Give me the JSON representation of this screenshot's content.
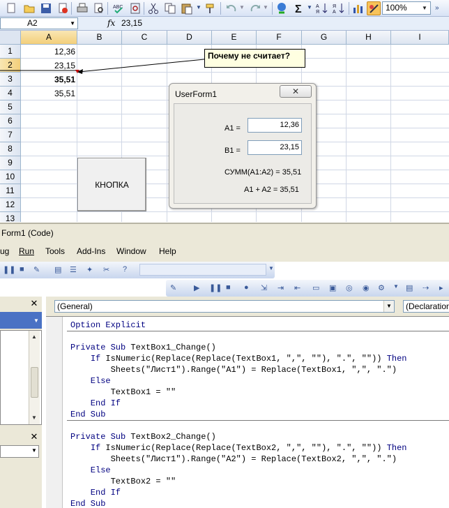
{
  "excel": {
    "zoom": "100%",
    "name_box": "A2",
    "fx": "fx",
    "formula_value": "23,15",
    "columns": [
      "A",
      "B",
      "C",
      "D",
      "E",
      "F",
      "G",
      "H",
      "I"
    ],
    "rows": [
      "1",
      "2",
      "3",
      "4",
      "5",
      "6",
      "7",
      "8",
      "9",
      "10",
      "11",
      "12",
      "13"
    ],
    "cells": {
      "a1": "12,36",
      "a2": "23,15",
      "a3": "35,51",
      "a4": "35,51"
    },
    "comment": "Почему не считает?",
    "sheet_button": "КНОПКА"
  },
  "userform": {
    "title": "UserForm1",
    "label_a1": "A1 =",
    "value_a1": "12,36",
    "label_b1": "B1 =",
    "value_b1": "23,15",
    "sum_text": "СУММ(A1:A2) = 35,51",
    "plus_text": "A1 + A2 = 35,51"
  },
  "vbe": {
    "window_title": "Form1 (Code)",
    "menu": [
      "ug",
      "Run",
      "Tools",
      "Add-Ins",
      "Window",
      "Help"
    ],
    "object_combo": "(General)",
    "proc_combo": "(Declaration",
    "code": [
      "Option Explicit",
      "",
      "Private Sub TextBox1_Change()",
      "    If IsNumeric(Replace(Replace(TextBox1, \",\", \"\"), \".\", \"\")) Then",
      "        Sheets(\"Лист1\").Range(\"A1\") = Replace(TextBox1, \",\", \".\")",
      "    Else",
      "        TextBox1 = \"\"",
      "    End If",
      "End Sub",
      "",
      "Private Sub TextBox2_Change()",
      "    If IsNumeric(Replace(Replace(TextBox2, \",\", \"\"), \".\", \"\")) Then",
      "        Sheets(\"Лист1\").Range(\"A2\") = Replace(TextBox2, \",\", \".\")",
      "    Else",
      "        TextBox2 = \"\"",
      "    End If",
      "End Sub"
    ]
  },
  "colors": {
    "toolbar": "#d8e3f5",
    "header_active": "#f3cf7a",
    "comment_bg": "#ffffe1",
    "keyword": "#000080",
    "vbe_bg": "#ebe8d8"
  },
  "icons": [
    "new-icon",
    "open-icon",
    "save-icon",
    "permission-icon",
    "print-icon",
    "print-preview-icon",
    "spelling-icon",
    "research-icon",
    "cut-icon",
    "copy-icon",
    "paste-icon",
    "format-painter-icon",
    "undo-icon",
    "redo-icon",
    "hyperlink-icon",
    "autosum-icon",
    "sort-ascending-icon",
    "sort-descending-icon",
    "chart-wizard-icon",
    "drawing-icon",
    "close-icon"
  ]
}
